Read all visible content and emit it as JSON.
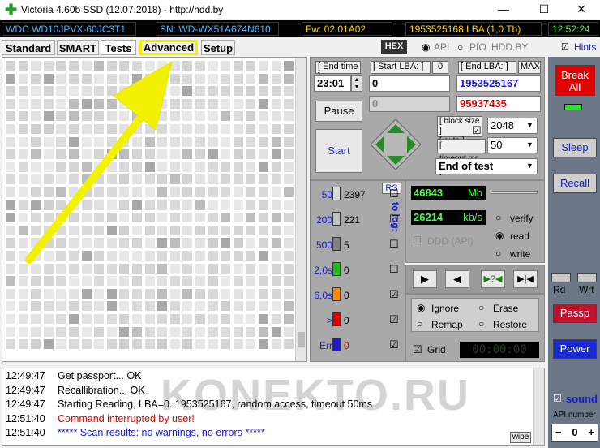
{
  "window": {
    "title": "Victoria 4.60b SSD (12.07.2018) - http://hdd.by",
    "min": "—",
    "max": "☐",
    "close": "✕"
  },
  "infobar": {
    "model": "WDC WD10JPVX-60JC3T1",
    "serial": "SN: WD-WX51A674N610",
    "firmware": "Fw: 02.01A02",
    "lba": "1953525168 LBA (1,0 Tb)",
    "time": "12:52:24"
  },
  "tabs": [
    "Standard",
    "SMART",
    "Tests",
    "Advanced",
    "Setup"
  ],
  "toolbar": {
    "hex": "HEX",
    "api": "API",
    "pio": "PIO",
    "hddby": "HDD.BY",
    "hints": "Hints"
  },
  "controls": {
    "end_time_label": "[ End time ]",
    "end_time_value": "23:01",
    "start_lba_label": "[ Start LBA: ]",
    "start_lba_zero": "0",
    "start_lba_value": "0",
    "start_lba_current": "0",
    "end_lba_label": "[ End LBA: ]",
    "end_lba_max": "MAX",
    "end_lba_value": "1953525167",
    "end_lba_current": "95937435",
    "pause": "Pause",
    "start": "Start",
    "block_size_label": "[ block size ]",
    "block_auto_label": "[ auto ]",
    "block_size_value": "2048",
    "timeout_label": "[ timeout,ms ]",
    "timeout_value": "50",
    "end_of_test": "End of test"
  },
  "legend": {
    "rs": "RS",
    "to_log": "to log:",
    "rows": [
      {
        "label": "50",
        "count": "2397",
        "color": "#d8d8d8"
      },
      {
        "label": "200",
        "count": "221",
        "color": "#c0c0c0"
      },
      {
        "label": "500",
        "count": "5",
        "color": "#808080"
      },
      {
        "label": "2,0s",
        "count": "0",
        "color": "#22bb22"
      },
      {
        "label": "6,0s",
        "count": "0",
        "color": "#ff8800"
      },
      {
        "label": ">",
        "count": "0",
        "color": "#e00000"
      },
      {
        "label": "Err",
        "count": "0",
        "color": "#1a1ad0"
      }
    ]
  },
  "stats": {
    "mb_value": "46843",
    "mb_unit": "Mb",
    "speed_value": "26214",
    "speed_unit": "kb/s",
    "ddd_api": "DDD (API)",
    "verify": "verify",
    "read": "read",
    "write": "write"
  },
  "actions": {
    "ignore": "Ignore",
    "erase": "Erase",
    "remap": "Remap",
    "restore": "Restore",
    "grid": "Grid",
    "timer": "00:00:00"
  },
  "rightbar": {
    "break_all": "Break All",
    "sleep": "Sleep",
    "recall": "Recall",
    "rd": "Rd",
    "wrt": "Wrt",
    "passp": "Passp",
    "power": "Power",
    "sound": "sound",
    "api_number_label": "API number",
    "api_number_value": "0"
  },
  "log": [
    {
      "time": "12:49:47",
      "text": "Get passport... OK",
      "color": "#000000"
    },
    {
      "time": "12:49:47",
      "text": "Recallibration... OK",
      "color": "#000000"
    },
    {
      "time": "12:49:47",
      "text": "Starting Reading, LBA=0..1953525167, random access, timeout 50ms",
      "color": "#000000"
    },
    {
      "time": "12:51:40",
      "text": "Command interrupted by user!",
      "color": "#e00000"
    },
    {
      "time": "12:51:40",
      "text": "***** Scan results: no warnings, no errors *****",
      "color": "#1a1ad0"
    }
  ],
  "wipe": "wipe",
  "watermark": "KONEKTO.RU"
}
